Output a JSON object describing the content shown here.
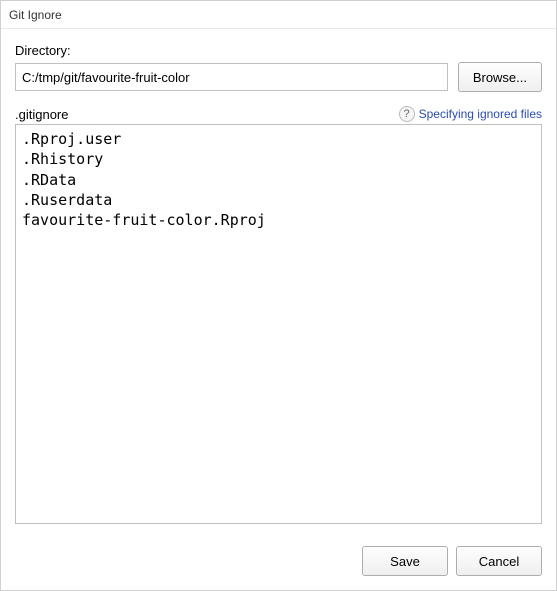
{
  "titlebar": {
    "title": "Git Ignore"
  },
  "directory": {
    "label": "Directory:",
    "value": "C:/tmp/git/favourite-fruit-color",
    "browse_label": "Browse..."
  },
  "gitignore": {
    "label": ".gitignore",
    "help_link_label": "Specifying ignored files",
    "content": ".Rproj.user\n.Rhistory\n.RData\n.Ruserdata\nfavourite-fruit-color.Rproj"
  },
  "footer": {
    "save_label": "Save",
    "cancel_label": "Cancel"
  }
}
